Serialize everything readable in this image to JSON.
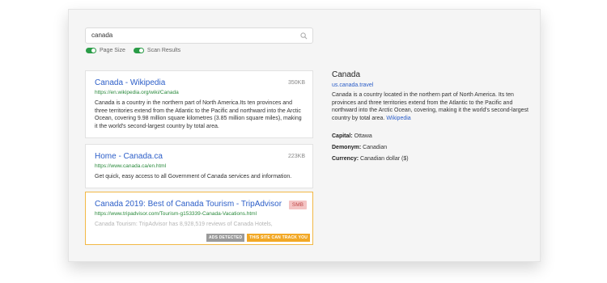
{
  "search": {
    "value": "canada"
  },
  "toggles": [
    {
      "label": "Page Size"
    },
    {
      "label": "Scan Results"
    }
  ],
  "results": [
    {
      "title": "Canada - Wikipedia",
      "size": "350KB",
      "url": "https://en.wikipedia.org/wiki/Canada",
      "description": "Canada is a country in the northern part of North America.Its ten provinces and three territories extend from the Atlantic to the Pacific and northward into the Arctic Ocean, covering 9.98 million square kilometres (3.85 million square miles), making it the world's second-largest country by total area."
    },
    {
      "title": "Home - Canada.ca",
      "size": "223KB",
      "url": "https://www.canada.ca/en.html",
      "description": "Get quick, easy access to all Government of Canada services and information."
    },
    {
      "title": "Canada 2019: Best of Canada Tourism - TripAdvisor",
      "badge": "SMB",
      "url": "https://www.tripadvisor.com/Tourism-g153339-Canada-Vacations.html",
      "description": "Canada Tourism: TripAdvisor has 8,928,519 reviews of Canada Hotels,",
      "tags": [
        "ADS DETECTED",
        "THIS SITE CAN TRACK YOU"
      ]
    }
  ],
  "knowledge_panel": {
    "title": "Canada",
    "url": "us.canada.travel",
    "description": "Canada is a country located in the northern part of North America. Its ten provinces and three territories extend from the Atlantic to the Pacific and northward into the Arctic Ocean, covering, making it the world's second-largest country by total area.",
    "link": "Wikipedia",
    "facts": [
      {
        "label": "Capital:",
        "value": "Ottawa"
      },
      {
        "label": "Demonym:",
        "value": "Canadian"
      },
      {
        "label": "Currency:",
        "value": "Canadian dollar ($)"
      }
    ]
  },
  "colors": {
    "accent": "#2c5ec8",
    "url_green": "#2a8a3c",
    "toggle_green": "#2a9c47",
    "tracker_orange": "#f2a825"
  }
}
